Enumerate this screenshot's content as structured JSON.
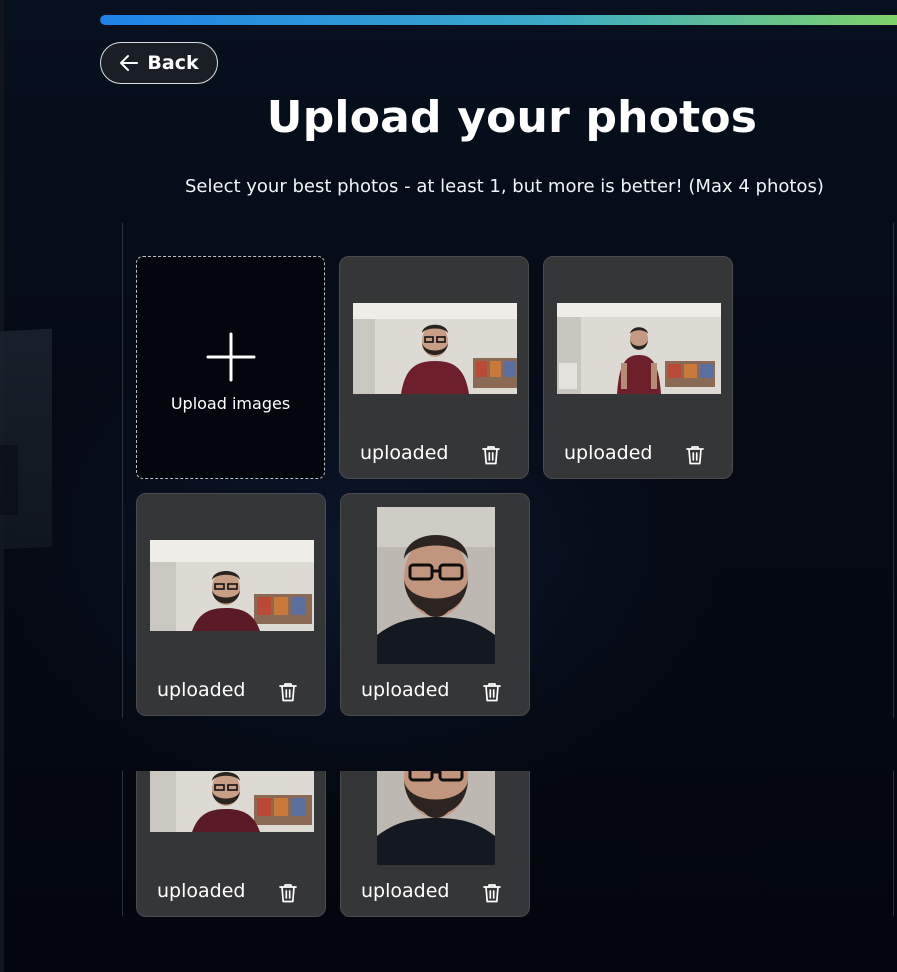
{
  "progress": {
    "fraction": 1.0
  },
  "back_button": {
    "label": "Back",
    "icon": "arrow-left-icon"
  },
  "page": {
    "title": "Upload your photos",
    "subtitle": "Select your best photos - at least 1, but more is better! (Max 4 photos)"
  },
  "upload_tile": {
    "label": "Upload images",
    "icon": "plus-icon"
  },
  "photos": [
    {
      "status": "uploaded",
      "orientation": "landscape",
      "icon": "trash-icon"
    },
    {
      "status": "uploaded",
      "orientation": "landscape",
      "icon": "trash-icon"
    },
    {
      "status": "uploaded",
      "orientation": "landscape",
      "icon": "trash-icon"
    },
    {
      "status": "uploaded",
      "orientation": "portrait",
      "icon": "trash-icon"
    }
  ],
  "photos_repeat": [
    {
      "status": "uploaded",
      "orientation": "landscape",
      "icon": "trash-icon"
    },
    {
      "status": "uploaded",
      "orientation": "portrait",
      "icon": "trash-icon"
    }
  ],
  "colors": {
    "background": "#050912",
    "card": "#353638",
    "progress_start": "#1e82e8",
    "progress_end": "#7ed36b"
  }
}
